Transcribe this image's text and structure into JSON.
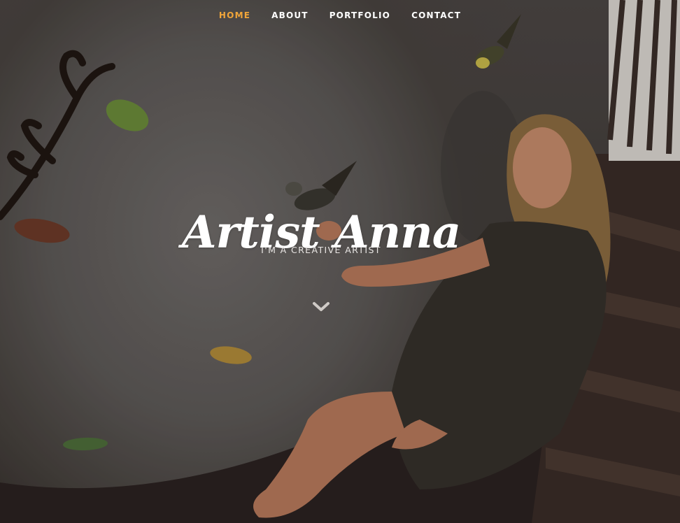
{
  "nav": {
    "items": [
      {
        "label": "HOME",
        "active": true
      },
      {
        "label": "ABOUT",
        "active": false
      },
      {
        "label": "PORTFOLIO",
        "active": false
      },
      {
        "label": "CONTACT",
        "active": false
      }
    ]
  },
  "hero": {
    "title": "Artist Anna",
    "subtitle": "I'M A CREATIVE ARTIST",
    "scroll_icon": "chevron-down-icon"
  },
  "colors": {
    "accent": "#f0a53a",
    "text": "#ffffff"
  }
}
